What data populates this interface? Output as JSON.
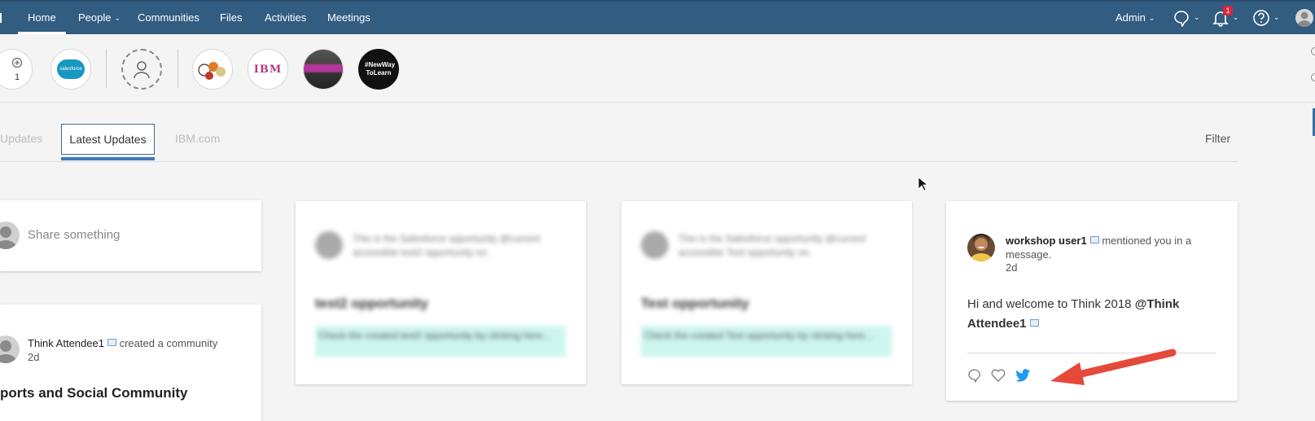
{
  "nav": {
    "items": [
      "Home",
      "People",
      "Communities",
      "Files",
      "Activities",
      "Meetings"
    ],
    "admin_label": "Admin",
    "notification_count": "1"
  },
  "strip": {
    "counter": "1",
    "logo_salesforce": "salesforce",
    "logo_ibm": "IBM",
    "logo_newway": "#NewWay ToLearn"
  },
  "tabs": {
    "prev": "Updates",
    "active": "Latest Updates",
    "next": "IBM.com",
    "filter": "Filter"
  },
  "share": {
    "placeholder": "Share something"
  },
  "community_post": {
    "author": "Think Attendee1",
    "action": "created a community",
    "time": "2d",
    "title": "ports and Social Community"
  },
  "opportunity_card_1": {
    "body": "This is the Salesforce opportunity @current accessible test2 opportunity on.",
    "title": "test2 opportunity",
    "link": "Check the created test2 opportunity by clicking here..."
  },
  "opportunity_card_2": {
    "body": "This is the Salesforce opportunity @current accessible Test opportunity on.",
    "title": "Test opportunity",
    "link": "Check the created Test opportunity by clicking here..."
  },
  "mention_card": {
    "author": "workshop user1",
    "action": "mentioned you in a message.",
    "time": "2d",
    "message": "Hi and welcome to Think 2018",
    "mention": "@Think Attendee1"
  },
  "colors": {
    "nav_bg": "#325c80",
    "accent": "#4178be",
    "twitter": "#1d9bf0",
    "arrow": "#e5493a"
  }
}
